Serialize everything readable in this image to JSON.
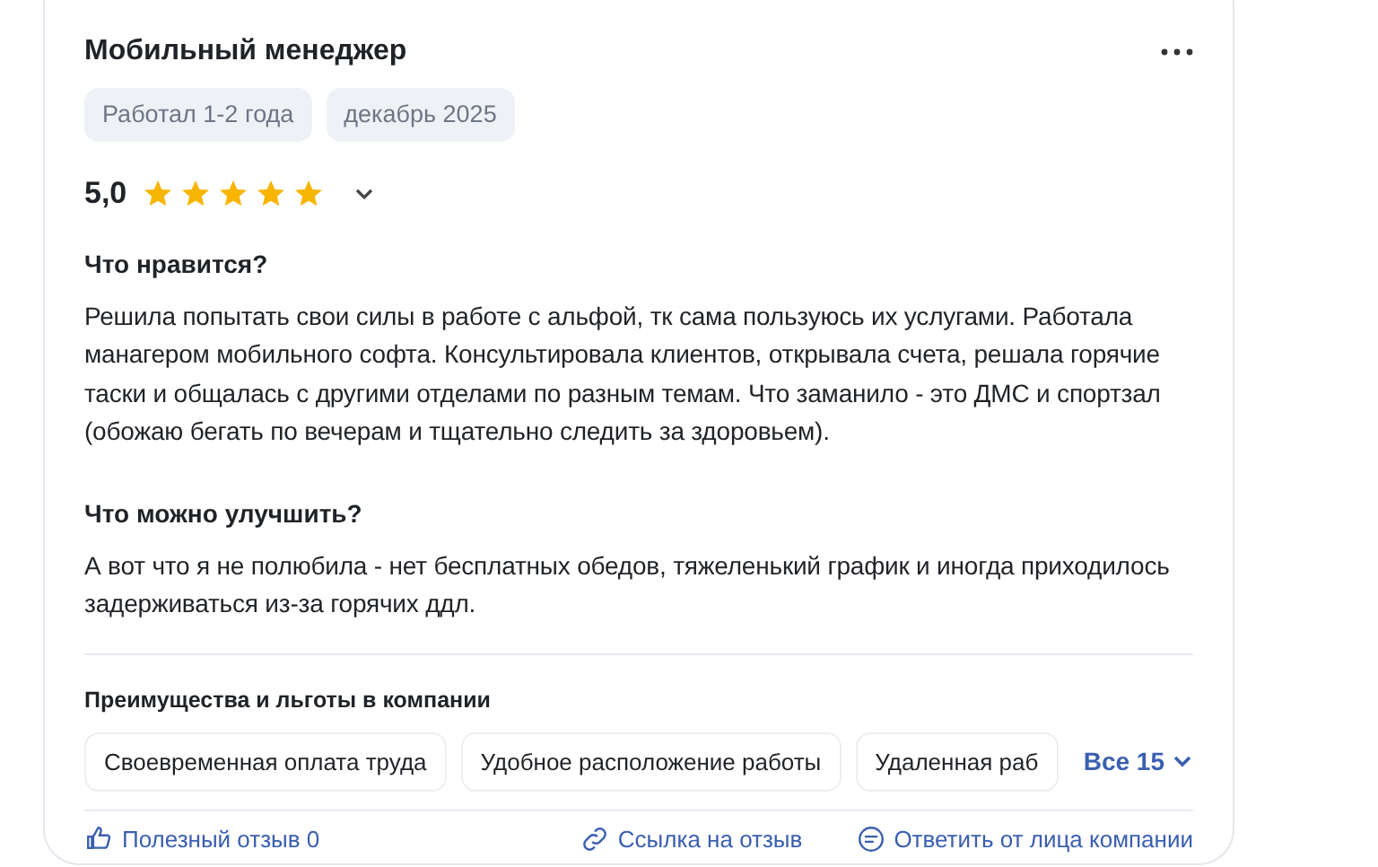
{
  "review": {
    "title": "Мобильный менеджер",
    "tags": [
      "Работал 1-2 года",
      "декабрь 2025"
    ],
    "rating": "5,0",
    "stars": 5,
    "sections": [
      {
        "heading": "Что нравится?",
        "text": "Решила попытать свои силы в работе с альфой, тк сама пользуюсь их услугами. Работала манагером мобильного софта. Консультировала клиентов, открывала счета, решала горячие таски и общалась с другими отделами по разным темам. Что заманило - это ДМС и спортзал (обожаю бегать по вечерам и тщательно следить за здоровьем)."
      },
      {
        "heading": "Что можно улучшить?",
        "text": "А вот что я не полюбила - нет бесплатных обедов, тяжеленький график и иногда приходилось задерживаться из-за горячих ддл."
      }
    ],
    "benefits": {
      "heading": "Преимущества и льготы в компании",
      "items": [
        "Своевременная оплата труда",
        "Удобное расположение работы",
        "Удаленная раб"
      ],
      "more": "Все 15"
    },
    "actions": [
      {
        "kind": "like",
        "label": "Полезный отзыв 0"
      },
      {
        "kind": "link",
        "label": "Ссылка на отзыв"
      },
      {
        "kind": "reply",
        "label": "Ответить от лица компании"
      }
    ]
  }
}
